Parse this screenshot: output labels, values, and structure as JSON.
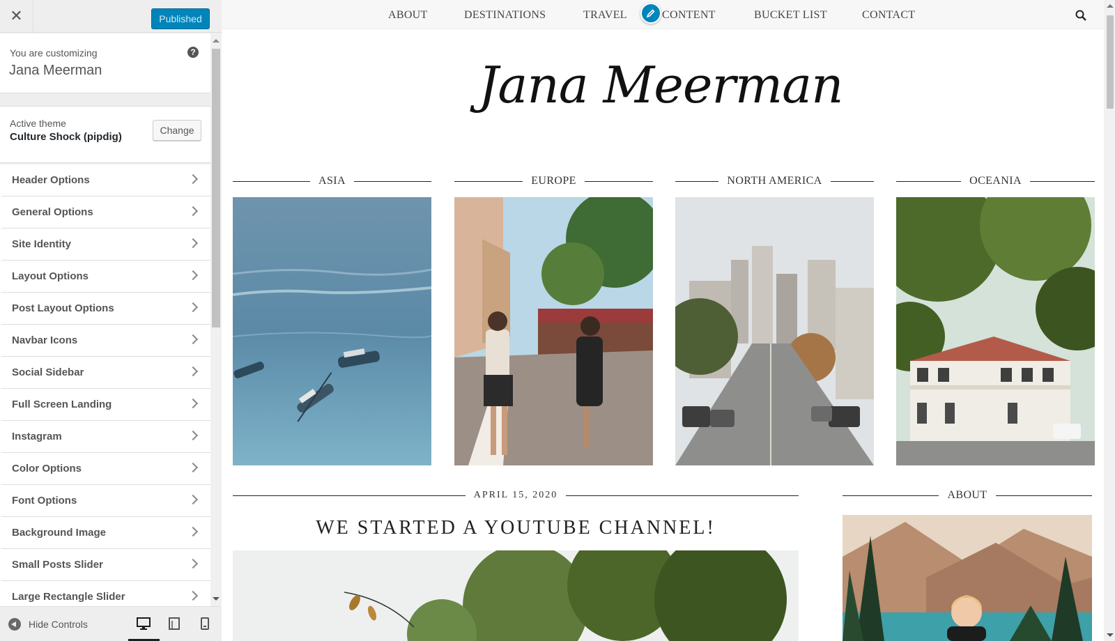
{
  "customizer": {
    "close_label": "✕",
    "publish_label": "Published",
    "info": {
      "label": "You are customizing",
      "site_name": "Jana Meerman"
    },
    "theme": {
      "label": "Active theme",
      "name": "Culture Shock (pipdig)",
      "change_label": "Change"
    },
    "menu": [
      {
        "label": "Header Options"
      },
      {
        "label": "General Options"
      },
      {
        "label": "Site Identity"
      },
      {
        "label": "Layout Options"
      },
      {
        "label": "Post Layout Options"
      },
      {
        "label": "Navbar Icons"
      },
      {
        "label": "Social Sidebar"
      },
      {
        "label": "Full Screen Landing"
      },
      {
        "label": "Instagram"
      },
      {
        "label": "Color Options"
      },
      {
        "label": "Font Options"
      },
      {
        "label": "Background Image"
      },
      {
        "label": "Small Posts Slider"
      },
      {
        "label": "Large Rectangle Slider"
      }
    ],
    "footer": {
      "hide_label": "Hide Controls",
      "active_device": "desktop"
    }
  },
  "preview": {
    "nav": [
      "ABOUT",
      "DESTINATIONS",
      "TRAVEL",
      "CONTENT",
      "BUCKET LIST",
      "CONTACT"
    ],
    "logo": "Jana Meerman",
    "categories": [
      "ASIA",
      "EUROPE",
      "NORTH AMERICA",
      "OCEANIA"
    ],
    "post": {
      "date": "APRIL 15, 2020",
      "title": "WE STARTED A YOUTUBE CHANNEL!"
    },
    "sidebar_heading": "ABOUT"
  },
  "colors": {
    "accent": "#0085ba",
    "sidebar_bg": "#eeeeee"
  }
}
